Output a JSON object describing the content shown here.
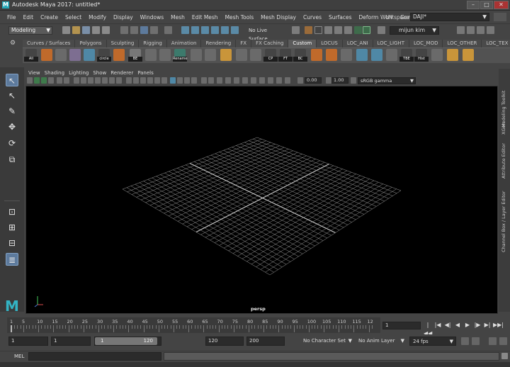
{
  "window": {
    "title": "Autodesk Maya 2017: untitled*",
    "logo_letter": "M",
    "buttons": {
      "minimize": "–",
      "maximize": "□",
      "close": "✕"
    }
  },
  "menubar": {
    "items": [
      "File",
      "Edit",
      "Create",
      "Select",
      "Modify",
      "Display",
      "Windows",
      "Mesh",
      "Edit Mesh",
      "Mesh Tools",
      "Mesh Display",
      "Curves",
      "Surfaces",
      "Deform",
      "UV",
      "Generate"
    ],
    "workspace_label": "Workspace :",
    "workspace_value": "DAJI*"
  },
  "statusline": {
    "mode": "Modeling",
    "live_surface": "No Live Surface",
    "user": "mijun kim"
  },
  "shelf": {
    "tabs": [
      "Curves / Surfaces",
      "Polygons",
      "Sculpting",
      "Rigging",
      "Animation",
      "Rendering",
      "FX",
      "FX Caching",
      "Custom",
      "LOCUS",
      "LOC_ANI",
      "LOC_LIGHT",
      "LOC_MOD",
      "LOC_OTHER",
      "LOC_TEX"
    ],
    "active_tab": "Custom",
    "button_labels": {
      "all": "All",
      "circle": "circle",
      "be": "BE",
      "rename": "Rename",
      "cp": "CP",
      "ft": "FT",
      "bc": "BC",
      "tbe": "TBE",
      "hist": "Hist"
    }
  },
  "panel": {
    "menu": [
      "View",
      "Shading",
      "Lighting",
      "Show",
      "Renderer",
      "Panels"
    ],
    "exposure": "0.00",
    "gamma": "1.00",
    "color_space": "sRGB gamma",
    "camera": "persp"
  },
  "side_tabs": [
    "Modeling Toolkit",
    "XGen",
    "Attribute Editor",
    "Channel Box / Layer Editor"
  ],
  "timeline": {
    "ticks": [
      "5",
      "10",
      "15",
      "20",
      "25",
      "30",
      "35",
      "40",
      "45",
      "50",
      "55",
      "60",
      "65",
      "70",
      "75",
      "80",
      "85",
      "90",
      "95",
      "100",
      "105",
      "110",
      "115",
      "12"
    ],
    "first_tick": "1",
    "current_frame": "1",
    "playback": [
      "|◀◀",
      "|◀",
      "◀|",
      "◀",
      "▶",
      "|▶",
      "▶|",
      "▶▶|"
    ]
  },
  "range": {
    "start": "1",
    "playback_start": "1",
    "range_start": "1",
    "range_end": "120",
    "playback_end": "120",
    "end": "200",
    "character_set": "No Character Set",
    "anim_layer": "No Anim Layer",
    "fps": "24 fps"
  },
  "command": {
    "label": "MEL"
  },
  "colors": {
    "accent": "#5d7a9c",
    "maya_teal": "#33b4c4",
    "grid": "#9a9a9a",
    "viewport_bg": "#000000"
  }
}
